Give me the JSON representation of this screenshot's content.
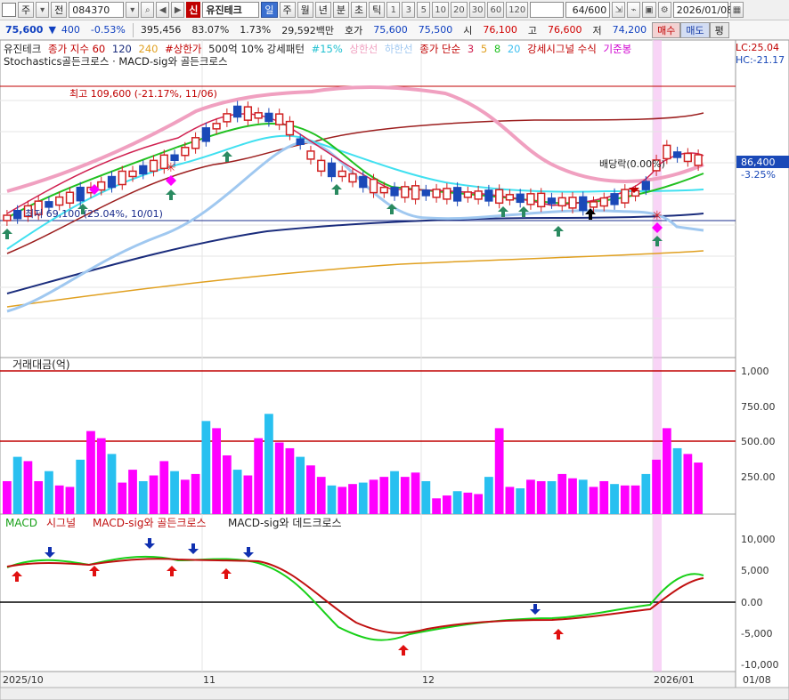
{
  "toolbar": {
    "period_label": "주",
    "view_label": "전",
    "stock_code": "084370",
    "credit_badge": "신",
    "stock_name": "유진테크",
    "period_tabs": [
      "일",
      "주",
      "월",
      "년",
      "분",
      "초",
      "틱"
    ],
    "active_tab": "일",
    "interval_buttons": [
      "1",
      "3",
      "5",
      "10",
      "20",
      "30",
      "60",
      "120"
    ],
    "page_count": "64/600",
    "date": "2026/01/08",
    "buy_label": "매수",
    "sell_label": "매도",
    "eval_label": "평"
  },
  "quote": {
    "price": "75,600",
    "change": "400",
    "change_pct": "-0.53%",
    "volume": "395,456",
    "ratio": "83.07%",
    "turnover": "1.73%",
    "amount": "29,592백만",
    "bid_label": "호가",
    "bid": "75,600",
    "ask": "75,500",
    "open_label": "시",
    "open": "76,100",
    "high_label": "고",
    "high": "76,600",
    "low_label": "저",
    "low": "74,200"
  },
  "legend_main": {
    "name": "유진테크",
    "ma_label": "종가 지수 60",
    "ma120": "120",
    "ma240": "240",
    "upper_limit_tag": "#상한가",
    "pattern": "500억 10% 강세패턴",
    "pct_tag": "#15%",
    "upper_line": "상한선",
    "lower_line": "하한선",
    "simple_ma": "종가 단순",
    "ma3": "3",
    "ma5": "5",
    "ma8": "8",
    "ma20": "20",
    "signal_formula": "강세시그널 수식",
    "base_candle": "기준봉",
    "second_line": "Stochastics골든크로스 · MACD-sig와 골든크로스",
    "lc": "LC:25.04",
    "hc": "HC:-21.17"
  },
  "annotations": {
    "high_note": "최고 109,600 (-21.17%, 11/06)",
    "low_note": "최저 69,100 (25.04%, 10/01)",
    "dividend_note": "배당락(0.00%)",
    "current_price": "86,400",
    "current_pct": "-3.25%"
  },
  "volume_panel": {
    "title": "거래대금(억)",
    "ticks": [
      "1,000",
      "750.00",
      "500.00",
      "250.00"
    ]
  },
  "macd_panel": {
    "legend_macd": "MACD",
    "legend_signal": "시그널",
    "legend_golden": "MACD-sig와 골든크로스",
    "legend_dead": "MACD-sig와 데드크로스",
    "ticks": [
      "10,000",
      "5,000",
      "0.00",
      "-5,000",
      "-10,000"
    ]
  },
  "x_axis": {
    "labels": [
      "2025/10",
      "11",
      "12",
      "2026/01"
    ],
    "right_label": "01/08"
  },
  "chart_data": {
    "type": "candlestick",
    "volume_values": [
      230,
      400,
      370,
      230,
      300,
      200,
      190,
      380,
      580,
      530,
      420,
      220,
      310,
      230,
      270,
      370,
      300,
      240,
      280,
      650,
      600,
      410,
      310,
      270,
      530,
      700,
      500,
      460,
      400,
      340,
      260,
      200,
      190,
      210,
      220,
      240,
      260,
      300,
      260,
      290,
      230,
      110,
      130,
      160,
      150,
      140,
      260,
      600,
      190,
      180,
      240,
      230,
      230,
      280,
      250,
      240,
      190,
      230,
      210,
      200,
      200,
      280,
      380,
      600,
      460,
      420,
      360
    ],
    "macd_ylim": [
      -10000,
      10000
    ],
    "volume_ylim": [
      0,
      1000
    ],
    "colors": {
      "up": "#d02020",
      "down": "#1a49b8",
      "vol_up": "#ff00ff",
      "vol_down": "#28c0f0",
      "macd": "#18d018",
      "signal": "#c01010"
    }
  }
}
